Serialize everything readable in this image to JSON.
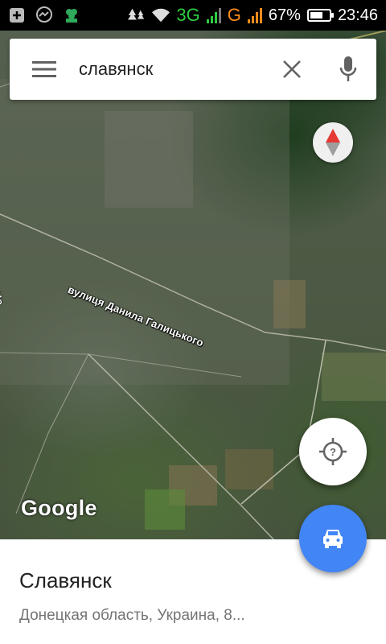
{
  "status_bar": {
    "network_3g": "3G",
    "network_g": "G",
    "battery_percent": "67%",
    "time": "23:46",
    "battery_level": 0.67,
    "icons": [
      "notification-add-icon",
      "messenger-icon",
      "clover-app-icon",
      "trees-icon",
      "wifi-icon",
      "signal-icon",
      "battery-icon"
    ]
  },
  "search": {
    "query": "славянск",
    "menu_icon": "hamburger-menu-icon",
    "clear_icon": "close-icon",
    "mic_icon": "microphone-icon"
  },
  "map": {
    "street_label": "вулиця Данила Галицького",
    "street_label_2": "Чо",
    "attribution": "Google",
    "compass_icon": "compass-icon"
  },
  "buttons": {
    "locate_icon": "my-location-icon",
    "directions_icon": "car-icon"
  },
  "place": {
    "name": "Славянск",
    "address": "Донецкая область, Украина, 8..."
  },
  "colors": {
    "directions_fab": "#4285f4",
    "compass_red": "#e53935"
  }
}
